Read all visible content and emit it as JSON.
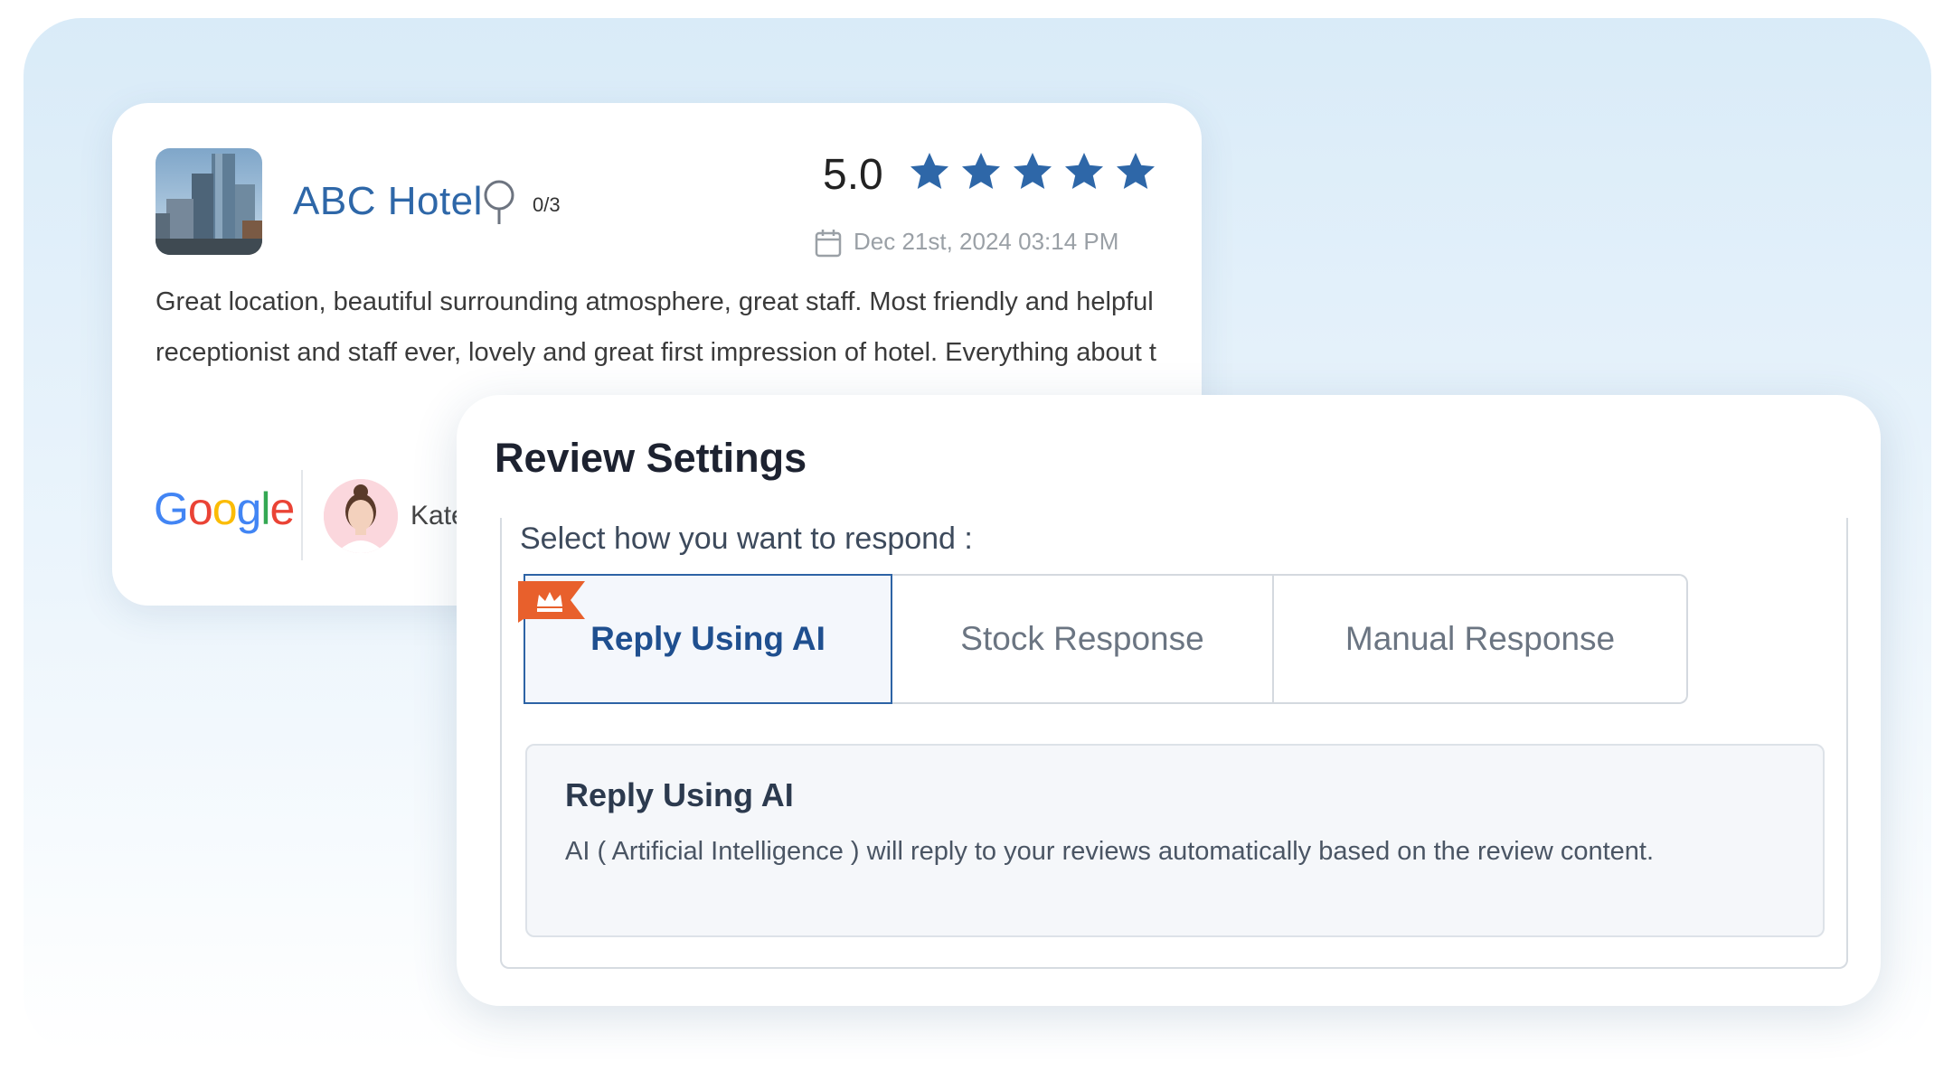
{
  "review": {
    "hotel_name": "ABC Hotel",
    "pin_count": "0/3",
    "rating": "5.0",
    "stars": 5,
    "date": "Dec 21st, 2024 03:14 PM",
    "text": "Great location, beautiful surrounding atmosphere, great staff. Most friendly and helpful receptionist and staff ever, lovely and great first impression of hotel. Everything about t",
    "source": "Google",
    "reviewer_name": "Kate",
    "star_color": "#2e67a8"
  },
  "settings": {
    "title": "Review Settings",
    "prompt": "Select how you want to respond :",
    "options": [
      {
        "label": "Reply Using AI",
        "selected": true,
        "premium": true
      },
      {
        "label": "Stock Response",
        "selected": false
      },
      {
        "label": "Manual Response",
        "selected": false
      }
    ],
    "description": {
      "title": "Reply Using AI",
      "body": "AI ( Artificial Intelligence ) will reply to your reviews automatically based on the review content."
    },
    "accent_color": "#2d63a5",
    "premium_badge_color": "#e8602c"
  },
  "icons": {
    "pin": "map-pin-icon",
    "calendar": "calendar-icon",
    "star": "star-icon",
    "crown": "crown-icon"
  }
}
